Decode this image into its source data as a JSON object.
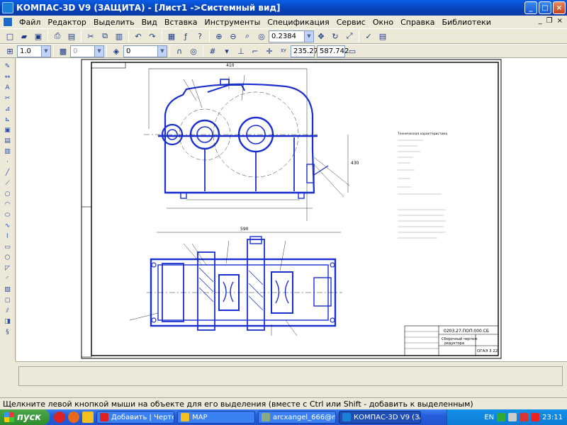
{
  "window": {
    "title": "КОМПАС-3D V9 (ЗАЩИТА) - [Лист1 ->Системный вид]",
    "minimize": "_",
    "maximize": "□",
    "close": "×"
  },
  "menu": [
    "Файл",
    "Редактор",
    "Выделить",
    "Вид",
    "Вставка",
    "Инструменты",
    "Спецификация",
    "Сервис",
    "Окно",
    "Справка",
    "Библиотеки"
  ],
  "mdi_controls": {
    "minimize": "_",
    "restore": "❐",
    "close": "×"
  },
  "toolbar1": {
    "zoom_value": "0.2384"
  },
  "toolbar2": {
    "line_scale": "1.0",
    "layer_state": "0",
    "style_value": "0",
    "coord_x": "235.275",
    "coord_y": "587.742"
  },
  "drawing": {
    "stamp_top": "0203.27.ПОП.000.СБ",
    "stamp_title1": "Сборочный чертеж",
    "stamp_title2": "редуктора",
    "stamp_group": "ОГАЭ 3 22",
    "notes": "Техническая характеристика",
    "dim_top": "410",
    "dim_bottom": "590",
    "dim_height": "430"
  },
  "status_hint": "Щелкните левой кнопкой мыши на объекте для его выделения (вместе с Ctrl или Shift - добавить к выделенным)",
  "taskbar": {
    "start_label": "пуск",
    "tasks": [
      "Добавить | Черте...",
      "MAP",
      "arcxangel_666@mai...",
      "КОМПАС-3D V9 (ЗА..."
    ],
    "lang": "EN",
    "clock": "23:11"
  },
  "colors": {
    "title_bar": "#0a5ee6",
    "drawing_blue": "#1a2fd0",
    "drawing_black": "#000000",
    "taskbar": "#245edb"
  }
}
